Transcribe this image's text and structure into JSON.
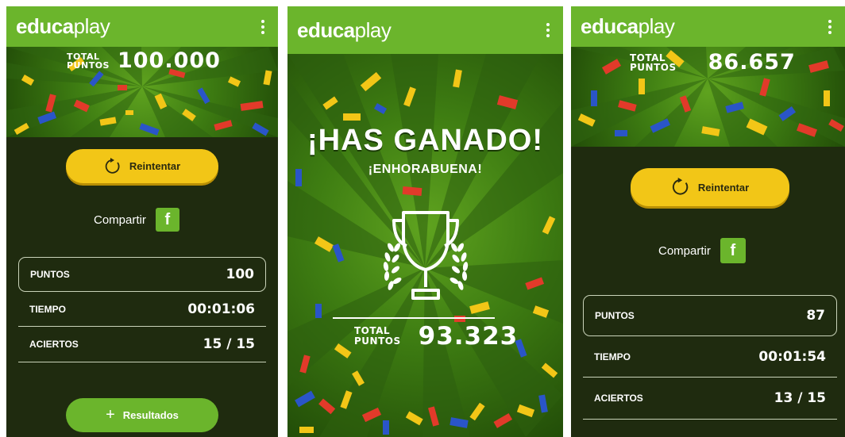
{
  "app": {
    "logo_bold": "educa",
    "logo_light": "play",
    "menu_icon": "kebab-menu-icon",
    "colors": {
      "brand_green": "#6bb52c",
      "dark_bg": "#1f2b0f",
      "yellow": "#f2c617",
      "hero_green": "#3e7d12"
    }
  },
  "screen1": {
    "total_label_1": "TOTAL",
    "total_label_2": "PUNTOS",
    "total_value": "100.000",
    "retry_label": "Reintentar",
    "share_label": "Compartir",
    "facebook_icon_text": "f",
    "stats": [
      {
        "label": "PUNTOS",
        "value": "100"
      },
      {
        "label": "TIEMPO",
        "value": "00:01:06"
      },
      {
        "label": "ACIERTOS",
        "value": "15 / 15"
      }
    ],
    "results_label": "Resultados",
    "results_icon": "+"
  },
  "screen2": {
    "headline": "¡HAS GANADO!",
    "subheadline": "¡ENHORABUENA!",
    "trophy_icon": "trophy-icon",
    "total_label_1": "TOTAL",
    "total_label_2": "PUNTOS",
    "total_value": "93.323"
  },
  "screen3": {
    "total_label_1": "TOTAL",
    "total_label_2": "PUNTOS",
    "total_value": "86.657",
    "retry_label": "Reintentar",
    "share_label": "Compartir",
    "facebook_icon_text": "f",
    "stats": [
      {
        "label": "PUNTOS",
        "value": "87"
      },
      {
        "label": "TIEMPO",
        "value": "00:01:54"
      },
      {
        "label": "ACIERTOS",
        "value": "13 / 15"
      }
    ]
  }
}
